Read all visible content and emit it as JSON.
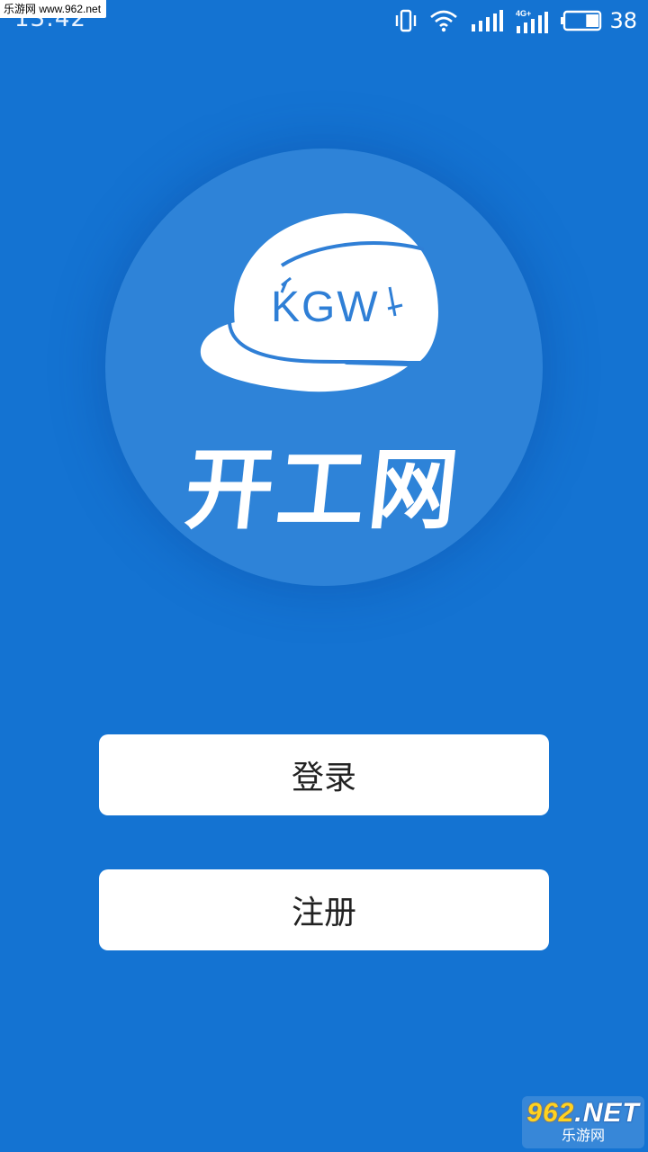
{
  "status_bar": {
    "time": "13:42",
    "network_type": "4G+",
    "battery_level": "38",
    "icons": [
      "vibrate-icon",
      "wifi-icon",
      "signal-icon",
      "signal-4g-icon",
      "battery-icon"
    ]
  },
  "watermark": {
    "top_left": "乐游网 www.962.net",
    "bottom_right_number": "962",
    "bottom_right_suffix": ".NET",
    "bottom_right_text": "乐游网"
  },
  "logo": {
    "helmet_text": "KGW",
    "title": "开工网"
  },
  "buttons": {
    "login_label": "登录",
    "register_label": "注册"
  },
  "colors": {
    "background": "#1473d2",
    "circle": "#2e83d8",
    "button": "#ffffff",
    "logo_accent": "#2f7fd6"
  }
}
